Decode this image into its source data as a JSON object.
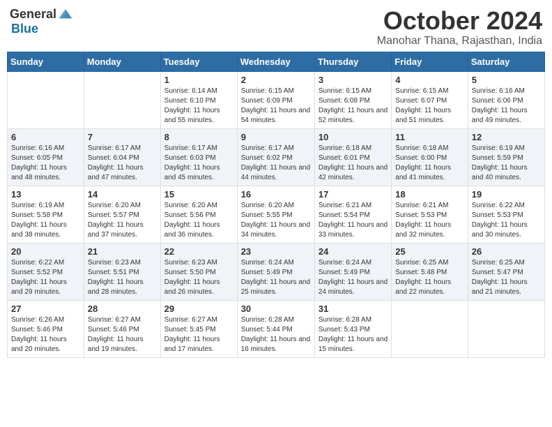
{
  "logo": {
    "general": "General",
    "blue": "Blue"
  },
  "title": "October 2024",
  "location": "Manohar Thana, Rajasthan, India",
  "weekdays": [
    "Sunday",
    "Monday",
    "Tuesday",
    "Wednesday",
    "Thursday",
    "Friday",
    "Saturday"
  ],
  "weeks": [
    [
      {
        "day": "",
        "info": ""
      },
      {
        "day": "",
        "info": ""
      },
      {
        "day": "1",
        "info": "Sunrise: 6:14 AM\nSunset: 6:10 PM\nDaylight: 11 hours and 55 minutes."
      },
      {
        "day": "2",
        "info": "Sunrise: 6:15 AM\nSunset: 6:09 PM\nDaylight: 11 hours and 54 minutes."
      },
      {
        "day": "3",
        "info": "Sunrise: 6:15 AM\nSunset: 6:08 PM\nDaylight: 11 hours and 52 minutes."
      },
      {
        "day": "4",
        "info": "Sunrise: 6:15 AM\nSunset: 6:07 PM\nDaylight: 11 hours and 51 minutes."
      },
      {
        "day": "5",
        "info": "Sunrise: 6:16 AM\nSunset: 6:06 PM\nDaylight: 11 hours and 49 minutes."
      }
    ],
    [
      {
        "day": "6",
        "info": "Sunrise: 6:16 AM\nSunset: 6:05 PM\nDaylight: 11 hours and 48 minutes."
      },
      {
        "day": "7",
        "info": "Sunrise: 6:17 AM\nSunset: 6:04 PM\nDaylight: 11 hours and 47 minutes."
      },
      {
        "day": "8",
        "info": "Sunrise: 6:17 AM\nSunset: 6:03 PM\nDaylight: 11 hours and 45 minutes."
      },
      {
        "day": "9",
        "info": "Sunrise: 6:17 AM\nSunset: 6:02 PM\nDaylight: 11 hours and 44 minutes."
      },
      {
        "day": "10",
        "info": "Sunrise: 6:18 AM\nSunset: 6:01 PM\nDaylight: 11 hours and 42 minutes."
      },
      {
        "day": "11",
        "info": "Sunrise: 6:18 AM\nSunset: 6:00 PM\nDaylight: 11 hours and 41 minutes."
      },
      {
        "day": "12",
        "info": "Sunrise: 6:19 AM\nSunset: 5:59 PM\nDaylight: 11 hours and 40 minutes."
      }
    ],
    [
      {
        "day": "13",
        "info": "Sunrise: 6:19 AM\nSunset: 5:58 PM\nDaylight: 11 hours and 38 minutes."
      },
      {
        "day": "14",
        "info": "Sunrise: 6:20 AM\nSunset: 5:57 PM\nDaylight: 11 hours and 37 minutes."
      },
      {
        "day": "15",
        "info": "Sunrise: 6:20 AM\nSunset: 5:56 PM\nDaylight: 11 hours and 36 minutes."
      },
      {
        "day": "16",
        "info": "Sunrise: 6:20 AM\nSunset: 5:55 PM\nDaylight: 11 hours and 34 minutes."
      },
      {
        "day": "17",
        "info": "Sunrise: 6:21 AM\nSunset: 5:54 PM\nDaylight: 11 hours and 33 minutes."
      },
      {
        "day": "18",
        "info": "Sunrise: 6:21 AM\nSunset: 5:53 PM\nDaylight: 11 hours and 32 minutes."
      },
      {
        "day": "19",
        "info": "Sunrise: 6:22 AM\nSunset: 5:53 PM\nDaylight: 11 hours and 30 minutes."
      }
    ],
    [
      {
        "day": "20",
        "info": "Sunrise: 6:22 AM\nSunset: 5:52 PM\nDaylight: 11 hours and 29 minutes."
      },
      {
        "day": "21",
        "info": "Sunrise: 6:23 AM\nSunset: 5:51 PM\nDaylight: 11 hours and 28 minutes."
      },
      {
        "day": "22",
        "info": "Sunrise: 6:23 AM\nSunset: 5:50 PM\nDaylight: 11 hours and 26 minutes."
      },
      {
        "day": "23",
        "info": "Sunrise: 6:24 AM\nSunset: 5:49 PM\nDaylight: 11 hours and 25 minutes."
      },
      {
        "day": "24",
        "info": "Sunrise: 6:24 AM\nSunset: 5:49 PM\nDaylight: 11 hours and 24 minutes."
      },
      {
        "day": "25",
        "info": "Sunrise: 6:25 AM\nSunset: 5:48 PM\nDaylight: 11 hours and 22 minutes."
      },
      {
        "day": "26",
        "info": "Sunrise: 6:25 AM\nSunset: 5:47 PM\nDaylight: 11 hours and 21 minutes."
      }
    ],
    [
      {
        "day": "27",
        "info": "Sunrise: 6:26 AM\nSunset: 5:46 PM\nDaylight: 11 hours and 20 minutes."
      },
      {
        "day": "28",
        "info": "Sunrise: 6:27 AM\nSunset: 5:46 PM\nDaylight: 11 hours and 19 minutes."
      },
      {
        "day": "29",
        "info": "Sunrise: 6:27 AM\nSunset: 5:45 PM\nDaylight: 11 hours and 17 minutes."
      },
      {
        "day": "30",
        "info": "Sunrise: 6:28 AM\nSunset: 5:44 PM\nDaylight: 11 hours and 16 minutes."
      },
      {
        "day": "31",
        "info": "Sunrise: 6:28 AM\nSunset: 5:43 PM\nDaylight: 11 hours and 15 minutes."
      },
      {
        "day": "",
        "info": ""
      },
      {
        "day": "",
        "info": ""
      }
    ]
  ]
}
